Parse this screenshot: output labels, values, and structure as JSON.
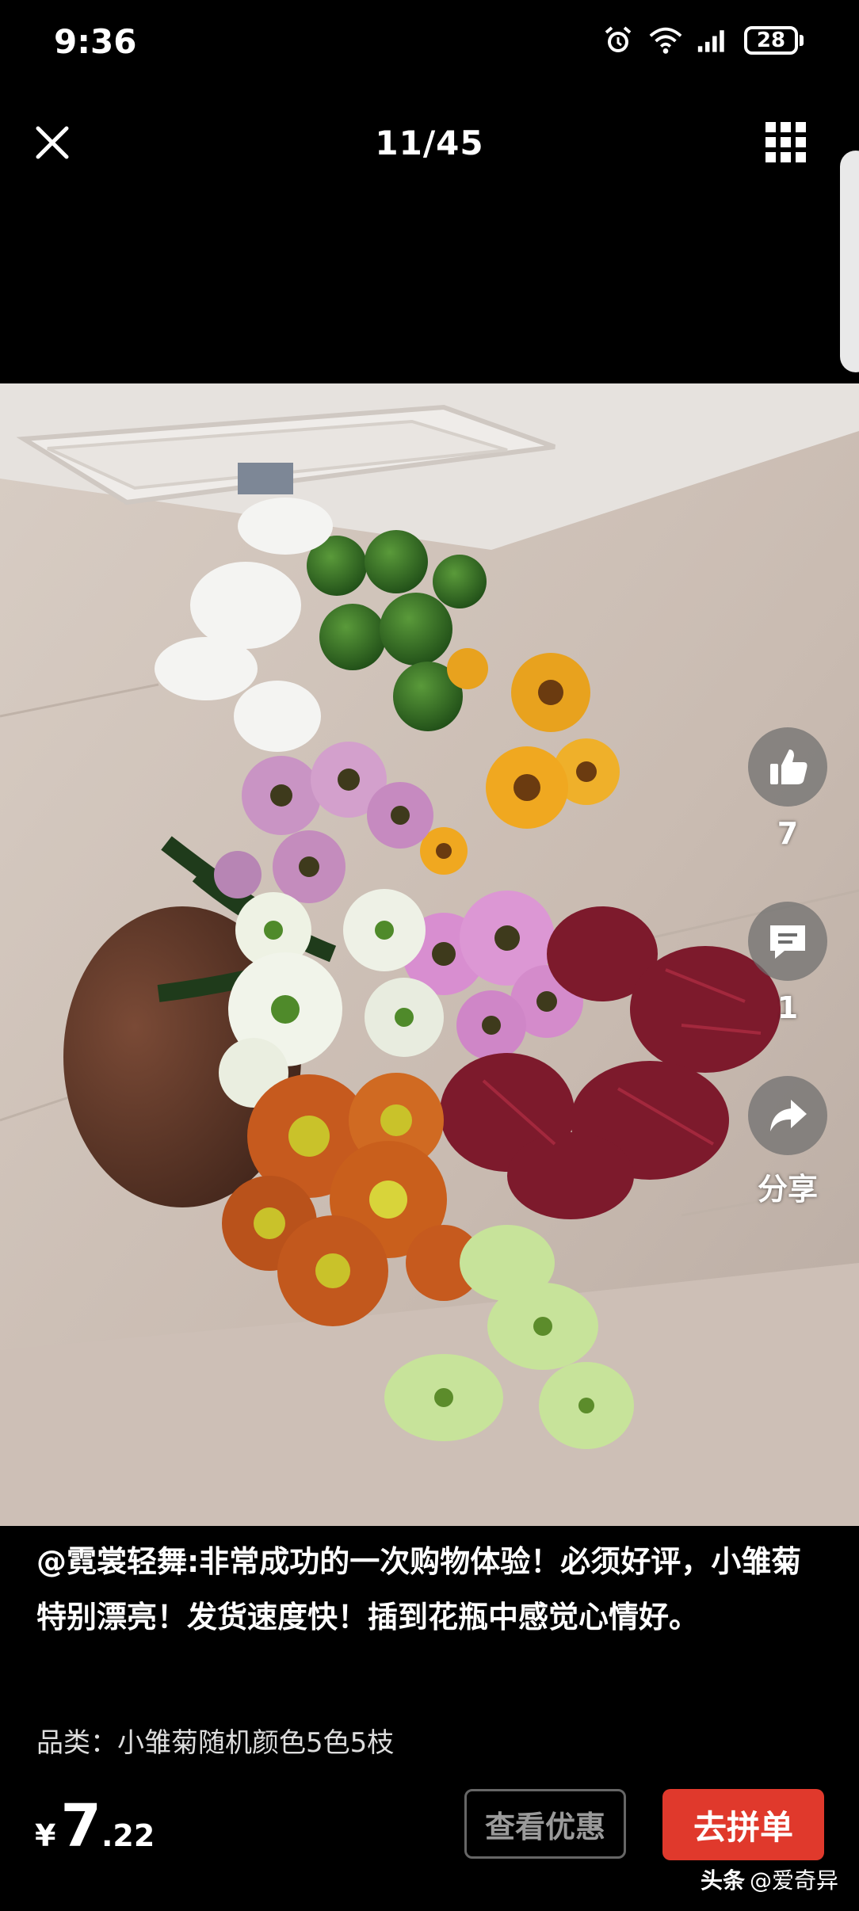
{
  "status_bar": {
    "time": "9:36",
    "battery_level": "28",
    "icons": [
      "alarm-icon",
      "wifi-icon",
      "signal-icon",
      "battery-icon"
    ]
  },
  "header": {
    "counter": "11/45",
    "left_icon": "close-icon",
    "right_icon": "grid-icon"
  },
  "photo": {
    "subject": "flower-bouquet-photo"
  },
  "actions": {
    "like": {
      "icon": "thumbs-up-icon",
      "count": "7"
    },
    "comment": {
      "icon": "comment-icon",
      "count": "1"
    },
    "share": {
      "icon": "share-icon",
      "label": "分享"
    }
  },
  "review": {
    "text": "@霓裳轻舞:非常成功的一次购物体验！必须好评，小雏菊特别漂亮！发货速度快！插到花瓶中感觉心情好。"
  },
  "product": {
    "category_text": "品类：小雏菊随机颜色5色5枝",
    "price_currency": "¥",
    "price_integer": "7",
    "price_decimal": ".22"
  },
  "buttons": {
    "coupon": "查看优惠",
    "group_buy": "去拼单"
  },
  "watermark": {
    "brand": "头条",
    "handle": "@爱奇异"
  },
  "colors": {
    "accent": "#e0392c",
    "background": "#000000"
  }
}
